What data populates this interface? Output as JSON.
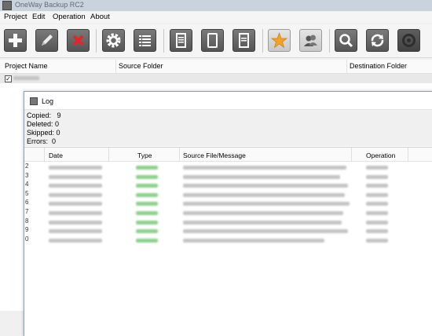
{
  "window": {
    "title": "OneWay Backup RC2"
  },
  "menu": [
    "Project",
    "Edit",
    "Operation",
    "About"
  ],
  "toolbar": [
    {
      "icon": "plus-icon"
    },
    {
      "icon": "pencil-icon"
    },
    {
      "icon": "delete-x-icon"
    },
    {
      "icon": "gear-icon"
    },
    {
      "icon": "list-icon"
    },
    {
      "icon": "document-icon"
    },
    {
      "icon": "tablet-icon"
    },
    {
      "icon": "page-icon"
    },
    {
      "icon": "star-icon"
    },
    {
      "icon": "users-icon"
    },
    {
      "icon": "search-icon"
    },
    {
      "icon": "refresh-icon"
    },
    {
      "icon": "stop-icon"
    }
  ],
  "project_table": {
    "columns": [
      "Project Name",
      "Source Folder",
      "Destination Folder"
    ],
    "rows": [
      {
        "checked": true
      }
    ]
  },
  "log": {
    "title": "Log",
    "stats": {
      "copied_label": "Copied:",
      "copied": "9",
      "deleted_label": "Deleted:",
      "deleted": "0",
      "skipped_label": "Skipped:",
      "skipped": "0",
      "errors_label": "Errors:",
      "errors": "0"
    },
    "columns": [
      "Date",
      "Type",
      "Source File/Message",
      "Operation"
    ],
    "row_numbers": [
      "2",
      "3",
      "4",
      "5",
      "6",
      "7",
      "8",
      "9",
      "0"
    ]
  },
  "colors": {
    "type_blur": "#8fcf8f",
    "text_blur": "#c4c4c4",
    "titlebar": "#c9d3de",
    "star": "#f2a224"
  }
}
